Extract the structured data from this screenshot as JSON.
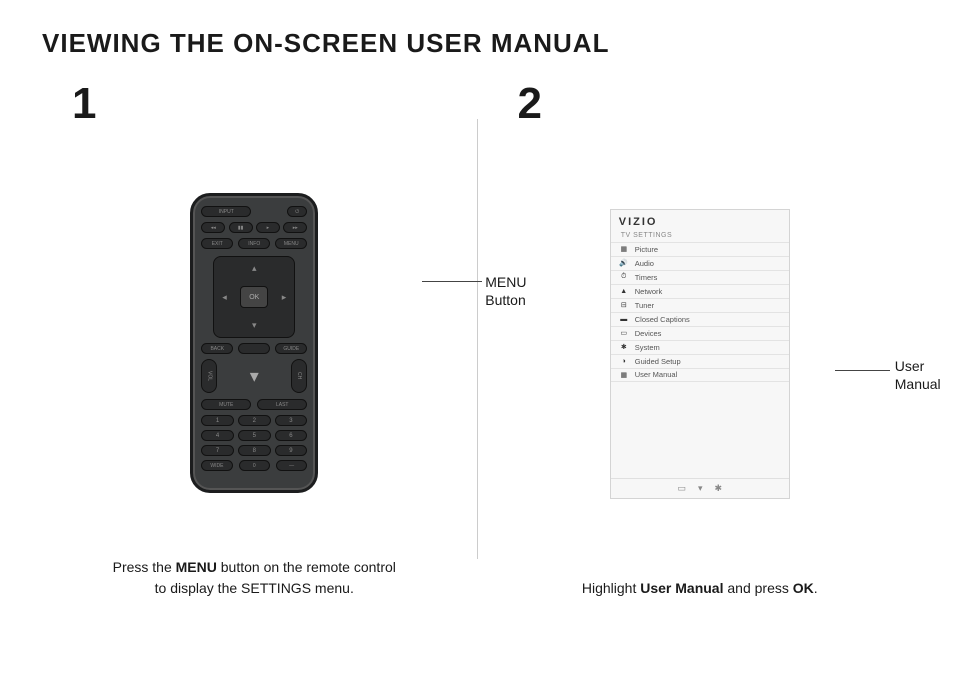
{
  "title": "VIEWING THE ON-SCREEN USER MANUAL",
  "steps": {
    "one": {
      "number": "1",
      "callout_line1": "MENU",
      "callout_line2": "Button",
      "caption_pre": "Press the ",
      "caption_bold": "MENU",
      "caption_mid": " button on the remote control",
      "caption_line2": "to display the SETTINGS menu."
    },
    "two": {
      "number": "2",
      "callout_line1": "User",
      "callout_line2": "Manual",
      "caption_pre": "Highlight ",
      "caption_bold": "User Manual",
      "caption_mid": " and press ",
      "caption_bold2": "OK",
      "caption_end": "."
    }
  },
  "remote": {
    "input": "INPUT",
    "exit": "EXIT",
    "menu": "MENU",
    "back": "BACK",
    "guide": "GUIDE",
    "info": "INFO",
    "ok": "OK",
    "vol": "VOL",
    "ch": "CH",
    "mute": "MUTE",
    "last": "LAST",
    "wide": "WIDE",
    "dash": "—",
    "nums": [
      "1",
      "2",
      "3",
      "4",
      "5",
      "6",
      "7",
      "8",
      "9",
      "0"
    ]
  },
  "tvmenu": {
    "brand": "VIZIO",
    "section": "TV SETTINGS",
    "items": [
      {
        "icon": "▦",
        "label": "Picture"
      },
      {
        "icon": "🔊",
        "label": "Audio"
      },
      {
        "icon": "⏱",
        "label": "Timers"
      },
      {
        "icon": "▲",
        "label": "Network"
      },
      {
        "icon": "⊟",
        "label": "Tuner"
      },
      {
        "icon": "▬",
        "label": "Closed Captions"
      },
      {
        "icon": "▭",
        "label": "Devices"
      },
      {
        "icon": "✱",
        "label": "System"
      },
      {
        "icon": "◑",
        "label": "Guided Setup"
      },
      {
        "icon": "▦",
        "label": "User Manual"
      }
    ],
    "footer_icons": [
      "▭",
      "▾",
      "✱"
    ]
  }
}
